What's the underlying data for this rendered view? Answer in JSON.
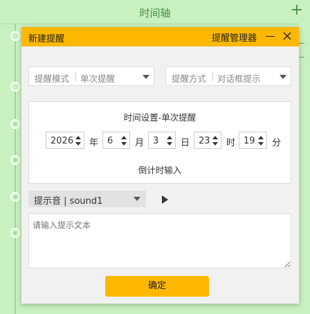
{
  "background": {
    "title": "时间轴",
    "add_icon": "plus-icon"
  },
  "dialog": {
    "title": "新建提醒",
    "manager_label": "提醒管理器",
    "mode": {
      "label": "提醒模式",
      "value": "单次提醒"
    },
    "method": {
      "label": "提醒方式",
      "value": "对话框提示"
    },
    "time_panel": {
      "title": "时间设置-单次提醒",
      "year": "2026",
      "year_unit": "年",
      "month": "6",
      "month_unit": "月",
      "day": "3",
      "day_unit": "日",
      "hour": "23",
      "hour_unit": "时",
      "minute": "19",
      "minute_unit": "分",
      "countdown_link": "倒计时输入"
    },
    "sound": {
      "label": "提示音",
      "value": "sound1"
    },
    "text": {
      "placeholder": "请输入提示文本"
    },
    "confirm_label": "确定"
  },
  "colors": {
    "accent": "#ffb800",
    "background": "#c9f1c0",
    "dialog_bg": "#f1f1f1"
  }
}
